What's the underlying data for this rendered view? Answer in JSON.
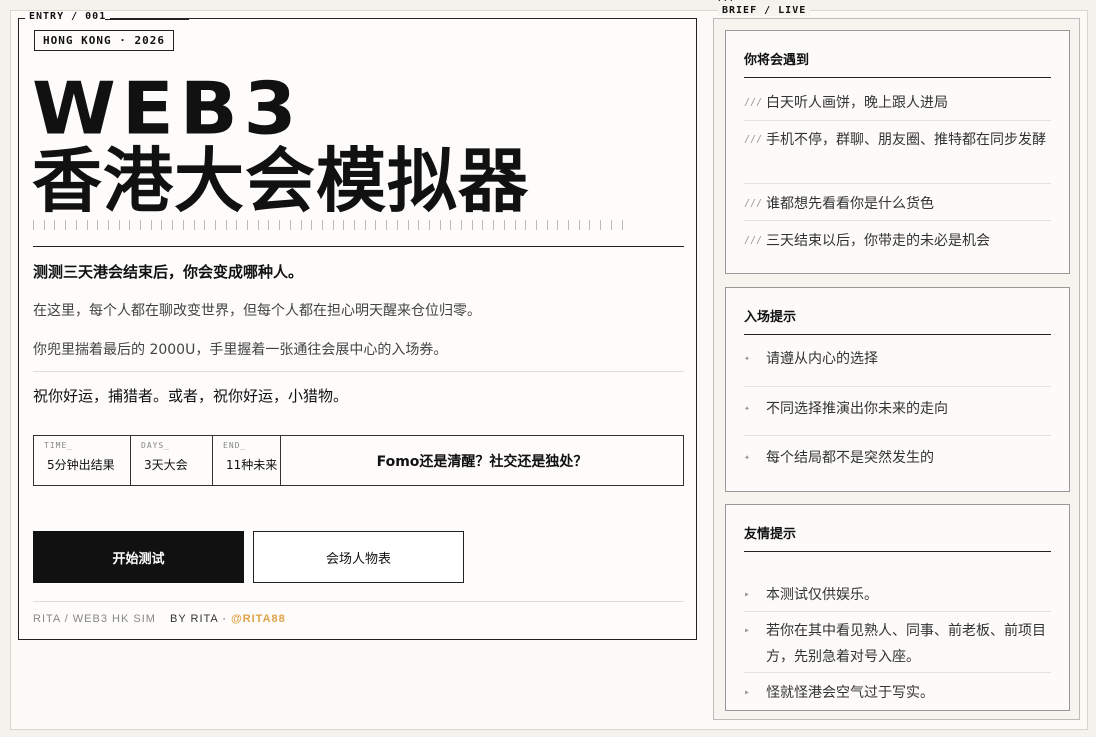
{
  "entry_tag": "ENTRY / 001",
  "location": "HONG KONG · 2026",
  "title_en": "WEB3",
  "title_cn": "香港大会模拟器",
  "lead": "测测三天港会结束后，你会变成哪种人。",
  "para1": "在这里，每个人都在聊改变世界，但每个人都在担心明天醒来仓位归零。",
  "para2": "你兜里揣着最后的 2000U，手里握着一张通往会展中心的入场券。",
  "blessing": "祝你好运，捕猎者。或者，祝你好运，小猎物。",
  "stats": [
    {
      "key": "TIME_",
      "value": "5分钟出结果"
    },
    {
      "key": "DAYS_",
      "value": "3天大会"
    },
    {
      "key": "END_",
      "value": "11种未来"
    }
  ],
  "question": "Fomo还是清醒？社交还是独处？",
  "buttons": {
    "start": "开始测试",
    "people": "会场人物表"
  },
  "footer": {
    "site": "RITA / WEB3 HK SIM",
    "by": "BY RITA ·",
    "handle": "@RITA88"
  },
  "brief": {
    "mark": "///",
    "tag": "BRIEF / LIVE",
    "cards": [
      {
        "title": "你将会遇到",
        "bullet": "///",
        "items": [
          "白天听人画饼，晚上跟人进局",
          "手机不停，群聊、朋友圈、推特都在同步发酵",
          "谁都想先看看你是什么货色",
          "三天结束以后，你带走的未必是机会"
        ]
      },
      {
        "title": "入场提示",
        "bullet": "✦",
        "items": [
          "请遵从内心的选择",
          "不同选择推演出你未来的走向",
          "每个结局都不是突然发生的"
        ]
      },
      {
        "title": "友情提示",
        "bullet": "▸",
        "items": [
          "本测试仅供娱乐。",
          "若你在其中看见熟人、同事、前老板、前项目方，先别急着对号入座。",
          "怪就怪港会空气过于写实。"
        ]
      }
    ]
  }
}
